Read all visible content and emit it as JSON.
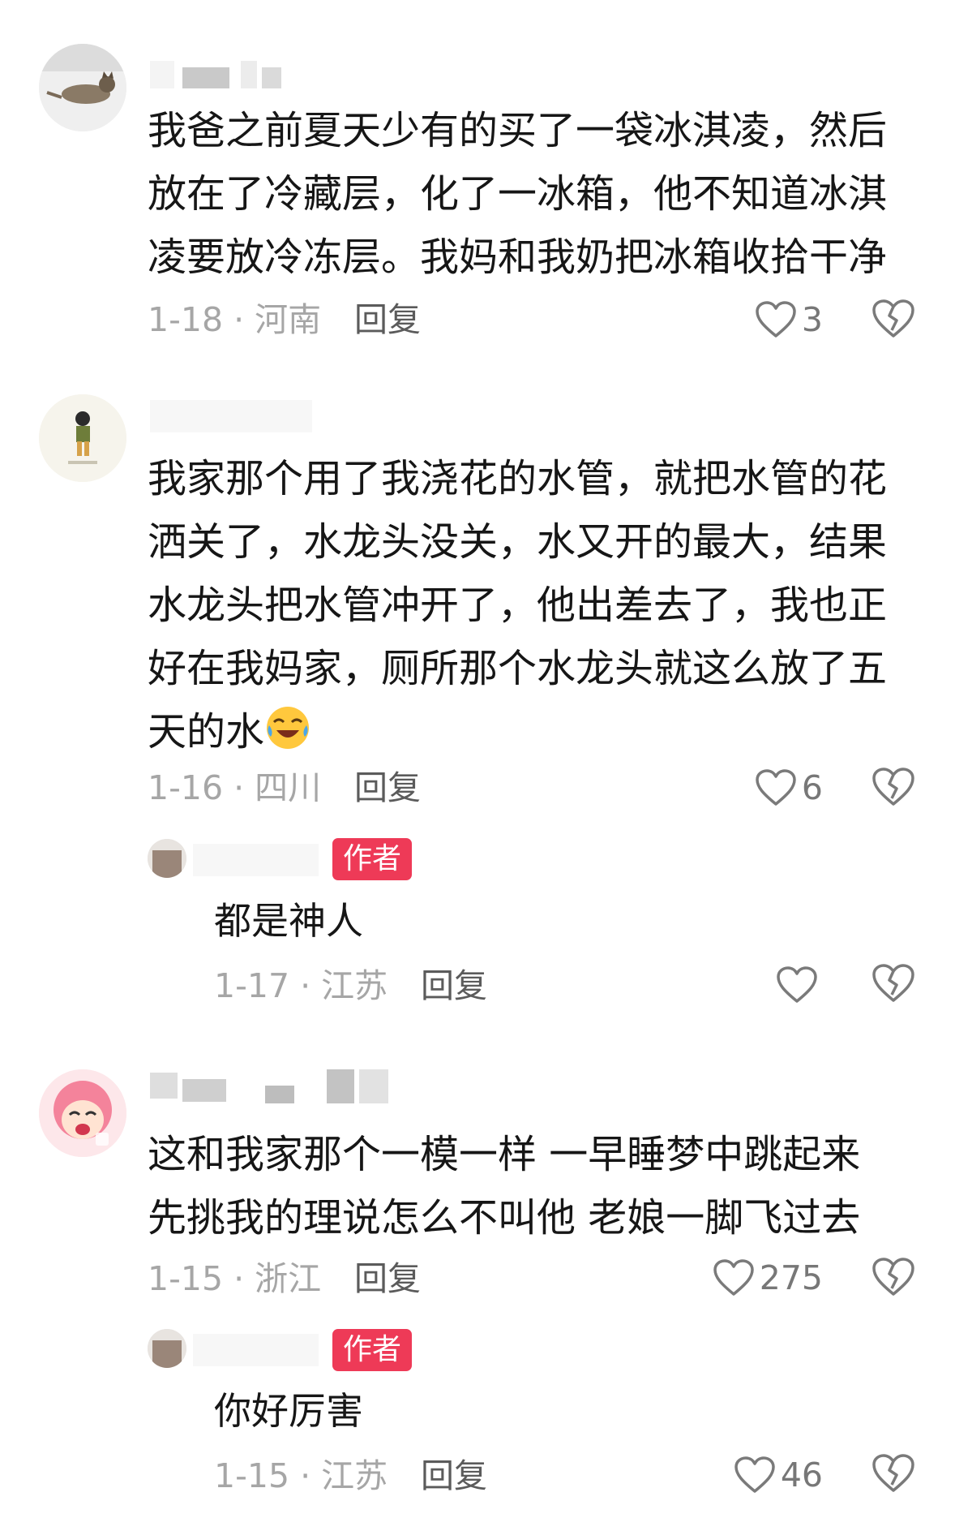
{
  "comments": [
    {
      "text_lines": [
        "我爸之前夏天少有的买了一袋冰淇凌，然后",
        "放在了冷藏层，化了一冰箱，他不知道冰淇",
        "凌要放冷冻层。我妈和我奶把冰箱收拾干净"
      ],
      "date_loc": "1-18 · 河南",
      "reply_label": "回复",
      "likes": "3"
    },
    {
      "text_lines": [
        "我家那个用了我浇花的水管，就把水管的花",
        "洒关了，水龙头没关，水又开的最大，结果",
        "水龙头把水管冲开了，他出差去了，我也正",
        "好在我妈家，厕所那个水龙头就这么放了五",
        "天的水"
      ],
      "date_loc": "1-16 · 四川",
      "reply_label": "回复",
      "likes": "6",
      "reply": {
        "badge": "作者",
        "text": "都是神人",
        "date_loc": "1-17 · 江苏",
        "reply_label": "回复",
        "likes": ""
      }
    },
    {
      "text_lines": [
        "这和我家那个一模一样  一早睡梦中跳起来",
        "先挑我的理说怎么不叫他 老娘一脚飞过去"
      ],
      "date_loc": "1-15 · 浙江",
      "reply_label": "回复",
      "likes": "275",
      "reply": {
        "badge": "作者",
        "text": "你好厉害",
        "date_loc": "1-15 · 江苏",
        "reply_label": "回复",
        "likes": "46"
      }
    }
  ],
  "icons": {
    "like": "heart-outline-icon",
    "dislike": "broken-heart-icon",
    "emoji": "crying-laughing-emoji"
  },
  "colors": {
    "badge": "#ee3a57",
    "meta": "#a6a6a6",
    "text": "#161616"
  }
}
